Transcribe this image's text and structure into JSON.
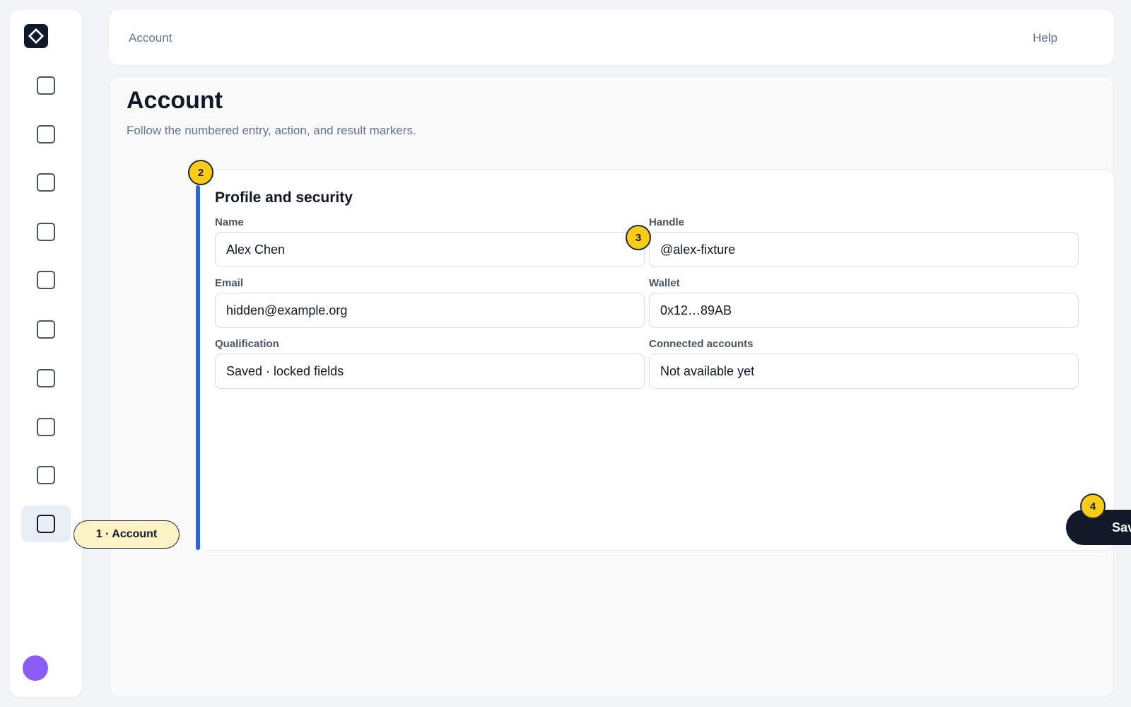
{
  "topbar": {
    "breadcrumb": "Account",
    "help_label": "Help"
  },
  "sidebar": {
    "logo_icon": "diamond-logo-icon",
    "items": [
      {
        "icon": "nav-square-icon",
        "active": false
      },
      {
        "icon": "nav-square-icon",
        "active": false
      },
      {
        "icon": "nav-square-icon",
        "active": false
      },
      {
        "icon": "nav-square-icon",
        "active": false
      },
      {
        "icon": "nav-square-icon",
        "active": false
      },
      {
        "icon": "nav-square-icon",
        "active": false
      },
      {
        "icon": "nav-square-icon",
        "active": false
      },
      {
        "icon": "nav-square-icon",
        "active": false
      },
      {
        "icon": "nav-square-icon",
        "active": false
      },
      {
        "icon": "nav-square-icon",
        "active": true
      }
    ],
    "avatar_color": "#8b5cf6"
  },
  "main": {
    "title": "Account",
    "subtitle": "Follow the numbered entry, action, and result markers."
  },
  "card": {
    "title": "Profile and security",
    "fields": {
      "name": {
        "label": "Name",
        "value": "Alex Chen"
      },
      "handle": {
        "label": "Handle",
        "value": "@alex-fixture"
      },
      "email": {
        "label": "Email",
        "value": "hidden@example.org"
      },
      "wallet": {
        "label": "Wallet",
        "value": "0x12…89AB"
      },
      "qualification": {
        "label": "Qualification",
        "value": "Saved · locked fields"
      },
      "connected": {
        "label": "Connected accounts",
        "value": "Not available yet"
      }
    },
    "save_label": "Save"
  },
  "markers": {
    "m1": "1 · Account",
    "m2": "2",
    "m3": "3",
    "m4": "4"
  },
  "colors": {
    "accent": "#2563eb",
    "marker": "#facc15",
    "marker_pill": "#fef3c7",
    "primary_button": "#111827"
  }
}
